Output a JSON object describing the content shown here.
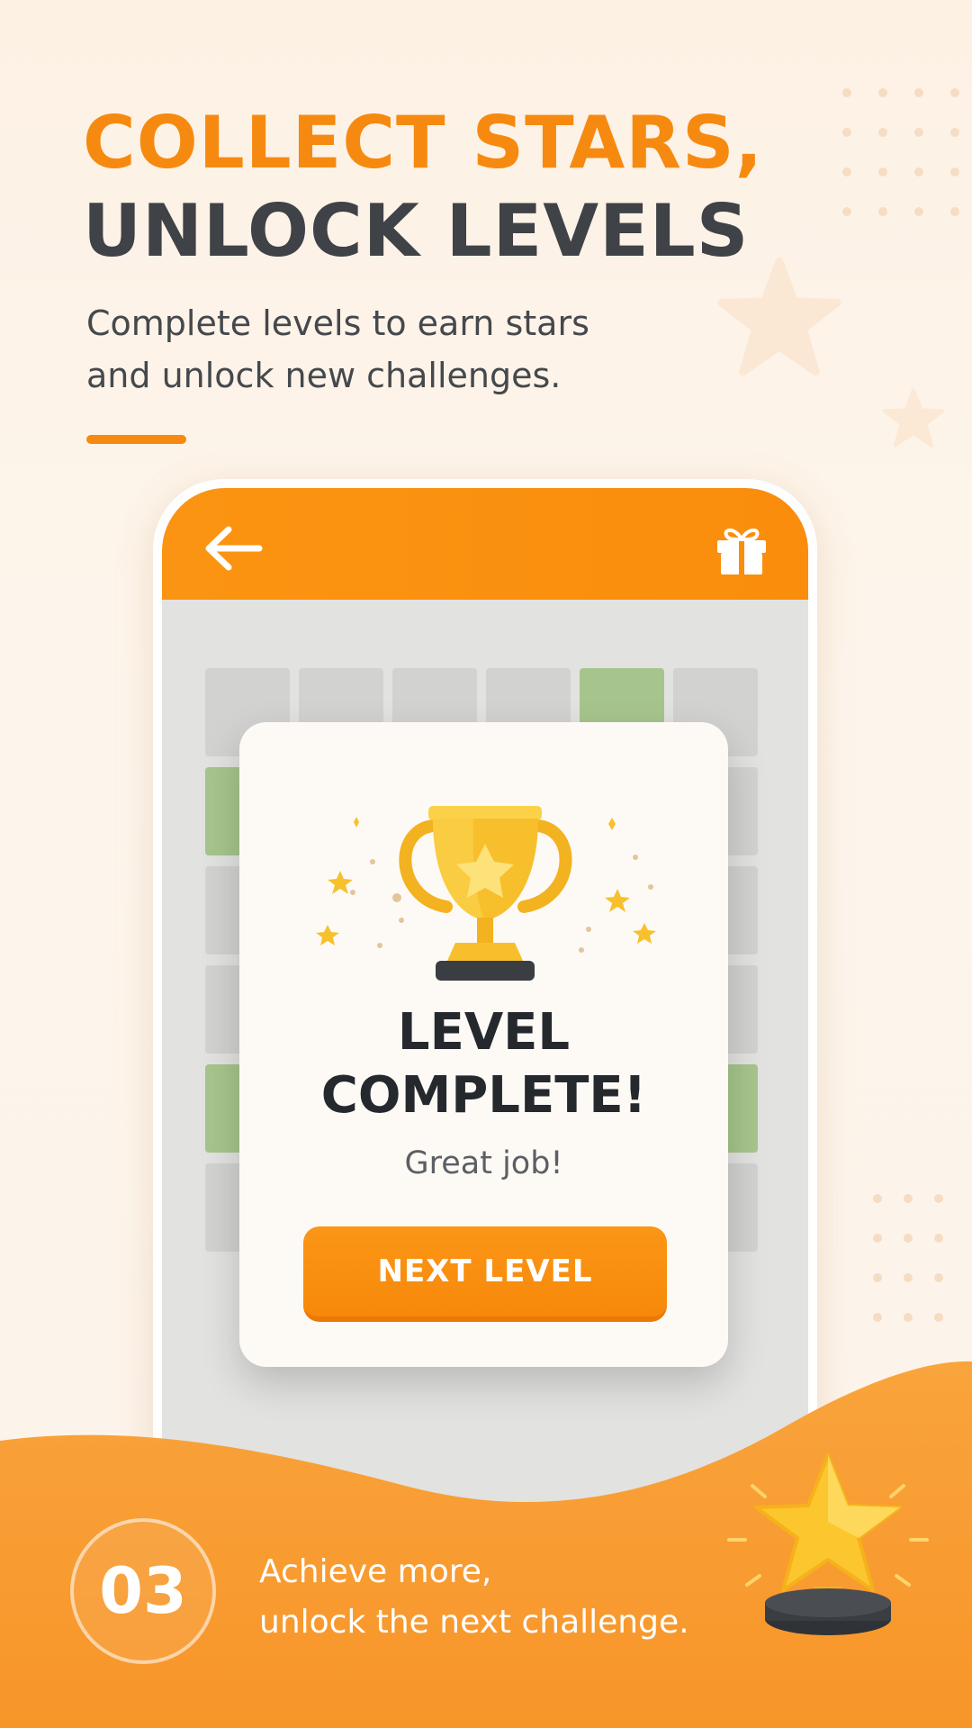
{
  "headline": {
    "line1": "COLLECT STARS,",
    "line2": "UNLOCK LEVELS"
  },
  "subtitle": "Complete levels to earn stars and unlock new challenges.",
  "colors": {
    "accent": "#f68a10",
    "dark_text": "#3f4246",
    "level_tile_green": "#a6c58c",
    "level_tile_gray": "#d2d2d0"
  },
  "app": {
    "back_icon": "arrow-left-icon",
    "gift_icon": "gift-icon",
    "level_grid_rows": [
      [
        "gray",
        "gray",
        "gray",
        "gray",
        "green",
        "gray"
      ],
      [
        "green",
        "gray",
        "gray",
        "gray",
        "gray",
        "gray"
      ],
      [
        "gray",
        "gray",
        "gray",
        "gray",
        "gray",
        "gray"
      ],
      [
        "gray",
        "gray",
        "gray",
        "gray",
        "gray",
        "gray"
      ],
      [
        "green",
        "gray",
        "gray",
        "gray",
        "gray",
        "green"
      ],
      [
        "gray",
        "gray",
        "gray",
        "gray",
        "gray",
        "gray"
      ]
    ]
  },
  "modal": {
    "icon": "trophy-icon",
    "title_line1": "LEVEL",
    "title_line2": "COMPLETE!",
    "message": "Great job!",
    "button_label": "NEXT LEVEL"
  },
  "footer": {
    "step_number": "03",
    "text_line1": "Achieve more,",
    "text_line2": "unlock the next challenge.",
    "icon": "star-trophy-icon"
  }
}
